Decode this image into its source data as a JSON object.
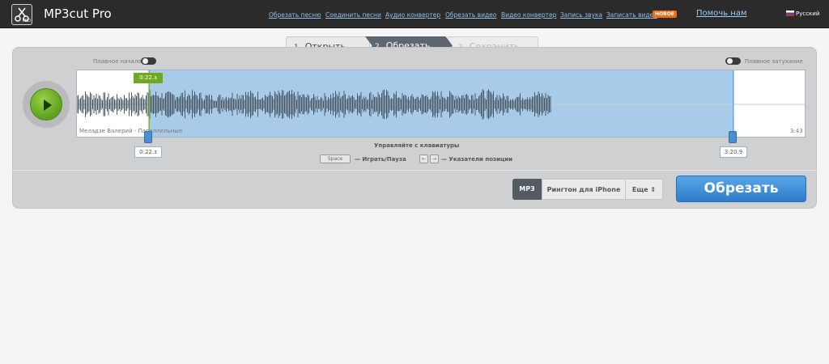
{
  "app": {
    "title": "MP3cut Pro",
    "logo_badge": "PRO"
  },
  "nav": {
    "items": [
      {
        "label": "Обрезать песню"
      },
      {
        "label": "Соединить песни"
      },
      {
        "label": "Аудио конвертер"
      },
      {
        "label": "Обрезать видео"
      },
      {
        "label": "Видео конвертер"
      },
      {
        "label": "Запись звука"
      },
      {
        "label": "Записать видео"
      }
    ],
    "new_badge": "НОВОЕ",
    "help_label": "Помочь нам",
    "language_label": "Русский"
  },
  "steps": [
    {
      "number": "1",
      "label": "Открыть",
      "state": "done"
    },
    {
      "number": "2",
      "label": "Обрезать",
      "state": "active"
    },
    {
      "number": "3",
      "label": "Сохранить",
      "state": "pending"
    }
  ],
  "editor": {
    "fade_in_label": "Плавное начало",
    "fade_out_label": "Плавное затухание",
    "fade_in_enabled": false,
    "fade_out_enabled": false,
    "track_name": "Меладзе Валерий - Параллельные",
    "total_duration": "3:43",
    "playhead_time": "0:22.з",
    "start_time": "0:22.з",
    "end_time": "3:20.9",
    "selection_start_fraction": 0.099,
    "selection_end_fraction": 0.9,
    "audio_end_fraction": 0.65
  },
  "keyboard": {
    "title": "Управляйте с клавиатуры",
    "space_key": "Space",
    "space_desc": "— Играть/Пауза",
    "left_key": "←",
    "right_key": "→",
    "arrows_desc": "— Указатели позиции"
  },
  "format": {
    "options": [
      "MP3",
      "Рингтон для iPhone"
    ],
    "more_label": "Еще",
    "selected": "MP3"
  },
  "actions": {
    "cut_label": "Обрезать"
  },
  "colors": {
    "accent_blue": "#3b8bd8",
    "play_green": "#6fa91f",
    "selection": "#a8cbea",
    "badge_new": "#ef6c12"
  }
}
